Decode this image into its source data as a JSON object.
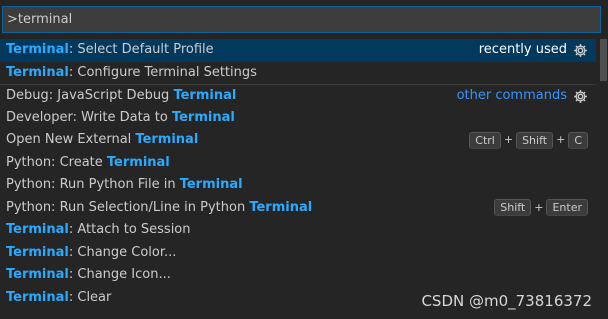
{
  "input": {
    "value": ">terminal"
  },
  "items": [
    {
      "highlight": "Terminal",
      "rest": ": Select Default Profile",
      "group": "recently used",
      "gear": true,
      "selected": true
    },
    {
      "highlight": "Terminal",
      "rest": ": Configure Terminal Settings"
    },
    {
      "prefix": "Debug: JavaScript Debug ",
      "highlight": "Terminal",
      "group": "other commands",
      "gear": true,
      "separator": true
    },
    {
      "prefix": "Developer: Write Data to ",
      "highlight": "Terminal"
    },
    {
      "prefix": "Open New External ",
      "highlight": "Terminal",
      "keys": [
        "Ctrl",
        "Shift",
        "C"
      ]
    },
    {
      "prefix": "Python: Create ",
      "highlight": "Terminal"
    },
    {
      "prefix": "Python: Run Python File in ",
      "highlight": "Terminal"
    },
    {
      "prefix": "Python: Run Selection/Line in Python ",
      "highlight": "Terminal",
      "keys": [
        "Shift",
        "Enter"
      ]
    },
    {
      "highlight": "Terminal",
      "rest": ": Attach to Session"
    },
    {
      "highlight": "Terminal",
      "rest": ": Change Color..."
    },
    {
      "highlight": "Terminal",
      "rest": ": Change Icon..."
    },
    {
      "highlight": "Terminal",
      "rest": ": Clear"
    }
  ],
  "watermark": "CSDN @m0_73816372",
  "icons": {
    "gear": "gear-icon"
  },
  "colors": {
    "highlight": "#2aaaff",
    "selected_bg": "#04395e",
    "focus_border": "#0e639c"
  }
}
